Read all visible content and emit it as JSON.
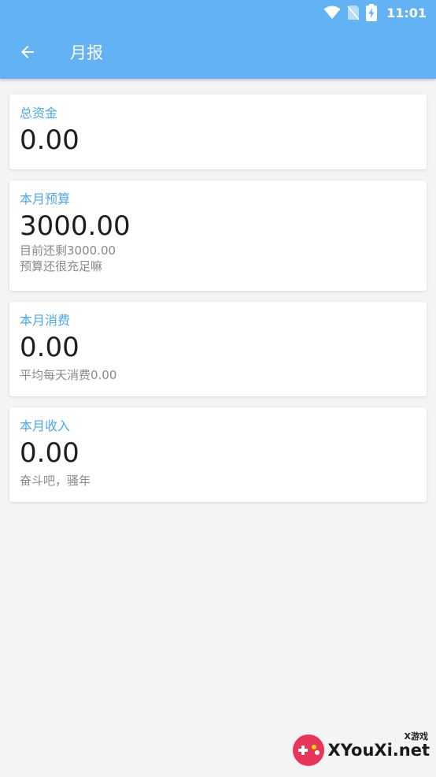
{
  "status_bar": {
    "time": "11:01",
    "icons": [
      "wifi-icon",
      "no-sim-icon",
      "battery-charging-icon"
    ]
  },
  "toolbar": {
    "back_icon": "arrow-left-icon",
    "title": "月报"
  },
  "cards": [
    {
      "label": "总资金",
      "value": "0.00",
      "notes": []
    },
    {
      "label": "本月预算",
      "value": "3000.00",
      "notes": [
        "目前还剩3000.00",
        "预算还很充足嘛"
      ]
    },
    {
      "label": "本月消费",
      "value": "0.00",
      "notes": [
        "平均每天消费0.00"
      ]
    },
    {
      "label": "本月收入",
      "value": "0.00",
      "notes": [
        "奋斗吧，骚年"
      ]
    }
  ],
  "watermark": {
    "subtitle": "X游戏",
    "text": "XYouXi.net"
  },
  "colors": {
    "appbar": "#63b3f4",
    "label": "#4ca8e8",
    "background": "#f4f4f4",
    "value_text": "#1e1e1e",
    "note_text": "#8a8a8a"
  }
}
